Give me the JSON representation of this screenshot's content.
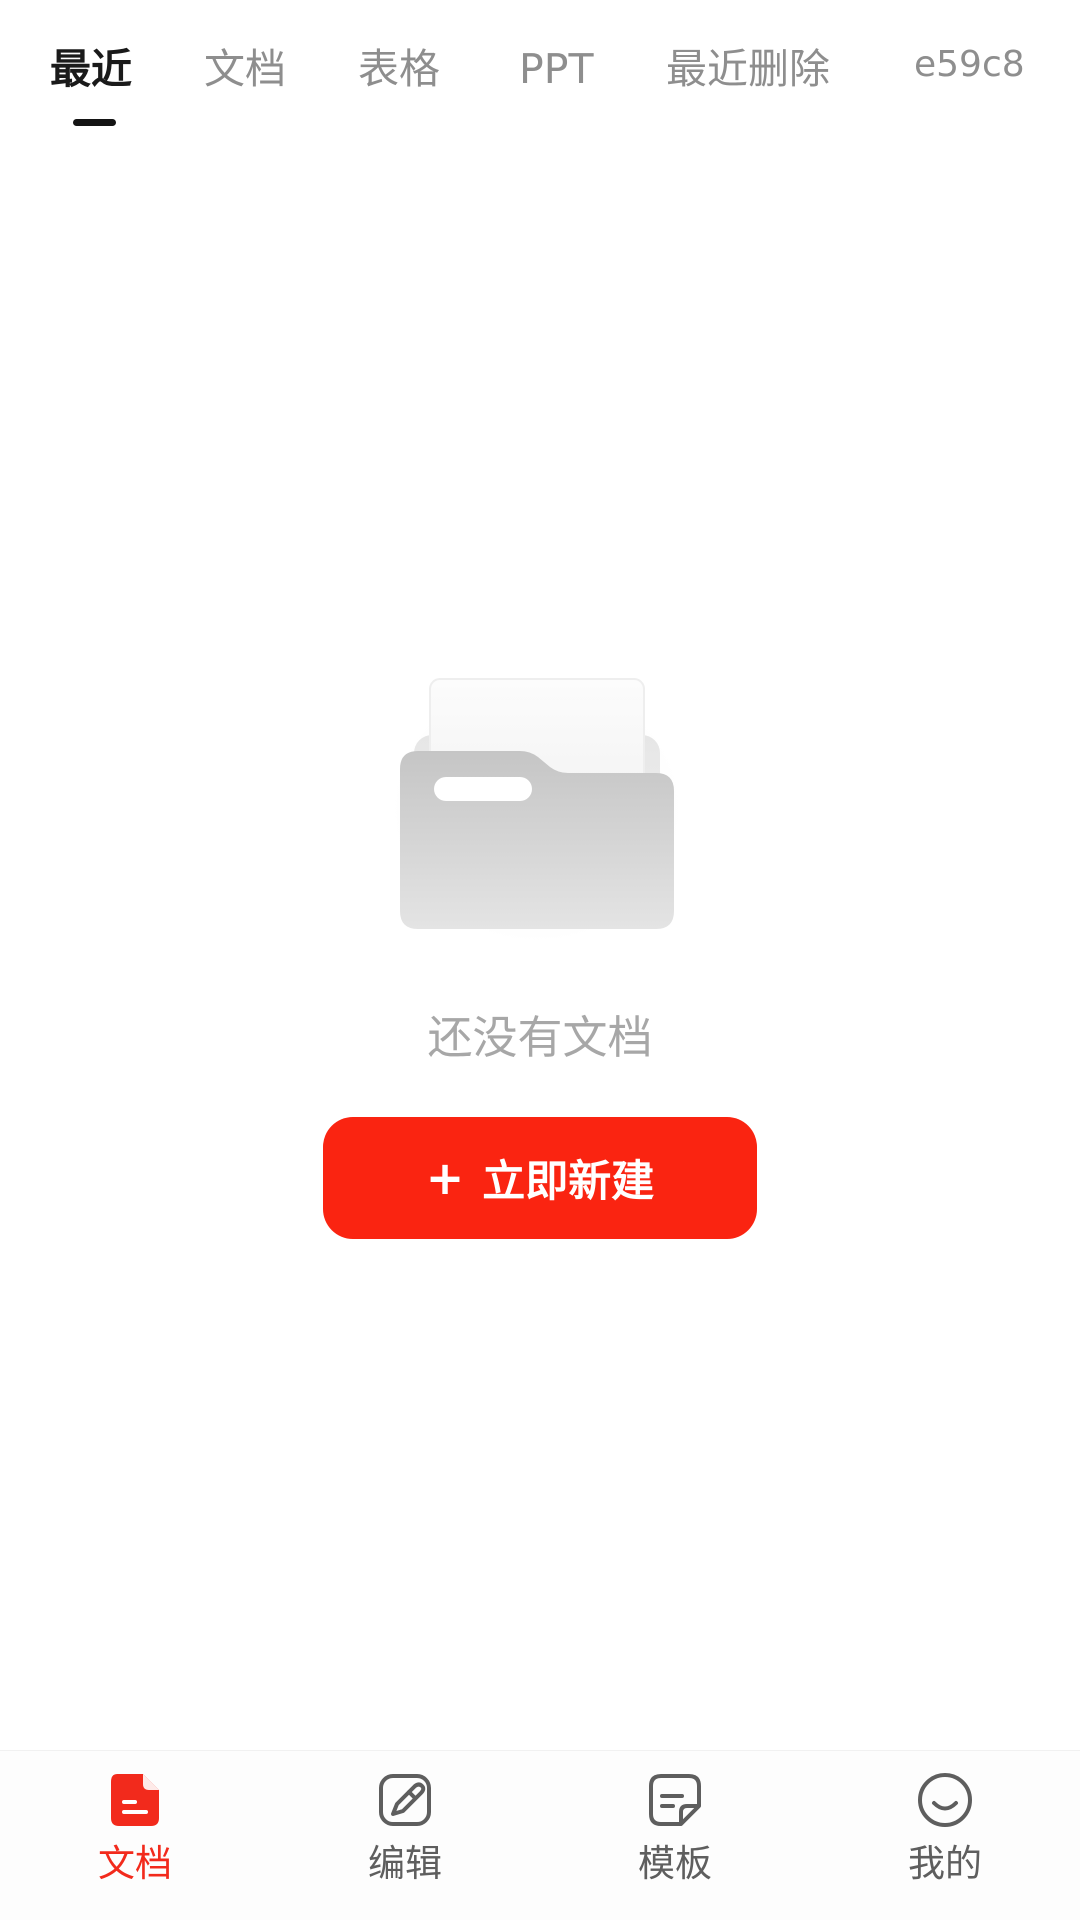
{
  "tabs": {
    "items": [
      {
        "label": "最近",
        "active": true
      },
      {
        "label": "文档",
        "active": false
      },
      {
        "label": "表格",
        "active": false
      },
      {
        "label": "PPT",
        "active": false
      },
      {
        "label": "最近删除",
        "active": false
      },
      {
        "label": "e59c8",
        "active": false
      }
    ]
  },
  "empty_state": {
    "illustration_icon": "folder-icon",
    "message": "还没有文档",
    "create_button": {
      "plus": "+",
      "label": "立即新建"
    }
  },
  "bottom_nav": {
    "items": [
      {
        "label": "文档",
        "icon": "document-icon",
        "active": true
      },
      {
        "label": "编辑",
        "icon": "edit-brush-icon",
        "active": false
      },
      {
        "label": "模板",
        "icon": "template-icon",
        "active": false
      },
      {
        "label": "我的",
        "icon": "profile-icon",
        "active": false
      }
    ]
  },
  "colors": {
    "accent": "#fa2411",
    "active_tab_text": "#1a1a1a",
    "inactive_tab_text": "#8e8e8e",
    "empty_text": "#a7a7a7",
    "nav_active": "#f22a1c",
    "nav_inactive": "#5e5e5e"
  }
}
